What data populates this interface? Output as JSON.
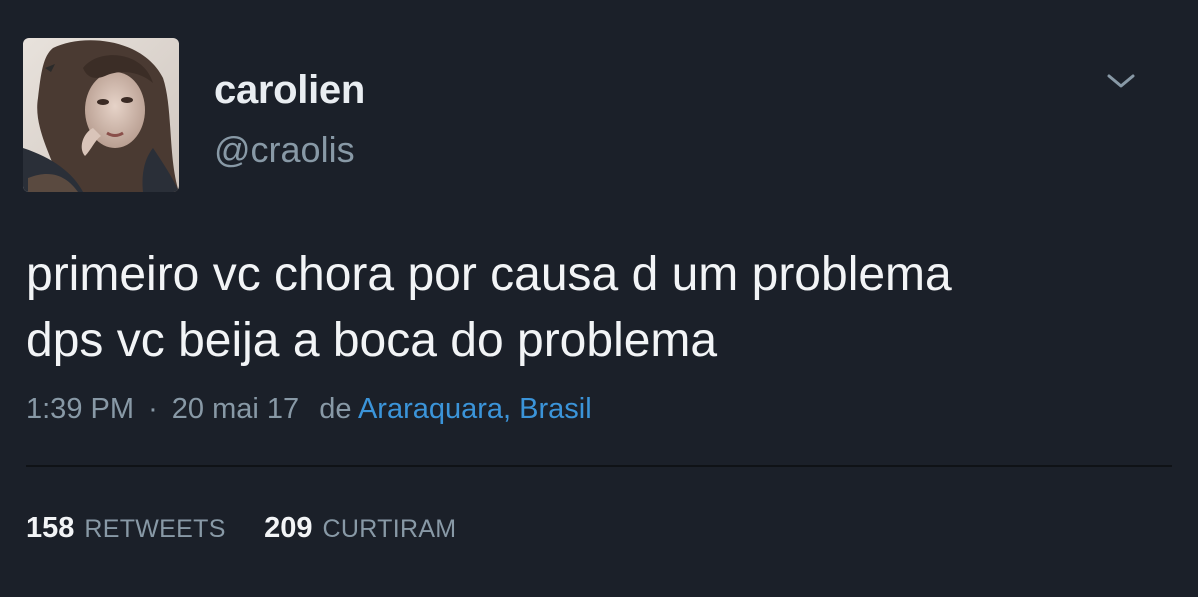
{
  "user": {
    "display_name": "carolien",
    "handle": "@craolis"
  },
  "tweet": {
    "lines": [
      "primeiro vc chora por causa d um problema",
      "dps vc beija a boca do problema"
    ],
    "time": "1:39 PM",
    "separator": "·",
    "date": "20 mai 17",
    "from_label": "de",
    "location": "Araraquara, Brasil"
  },
  "stats": {
    "retweets_count": "158",
    "retweets_label": "RETWEETS",
    "likes_count": "209",
    "likes_label": "CURTIRAM"
  },
  "icons": {
    "menu": "chevron-down-icon"
  },
  "colors": {
    "background": "#1b2029",
    "text": "#f2f4f6",
    "muted": "#8899a6",
    "link": "#3b94d9"
  }
}
